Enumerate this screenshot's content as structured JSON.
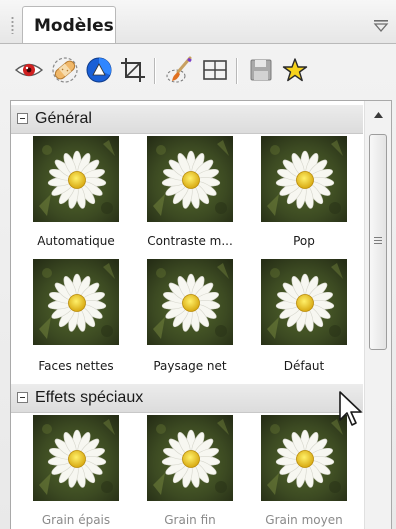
{
  "panel": {
    "tab_label": "Modèles"
  },
  "toolbar": {
    "icons": [
      "eye-icon",
      "bandage-icon",
      "color-wheel-icon",
      "crop-icon",
      "brush-icon",
      "grid-icon",
      "save-icon",
      "star-icon"
    ]
  },
  "groups": [
    {
      "label": "Général",
      "items": [
        {
          "label": "Automatique"
        },
        {
          "label": "Contraste m..."
        },
        {
          "label": "Pop"
        },
        {
          "label": "Faces nettes"
        },
        {
          "label": "Paysage net"
        },
        {
          "label": "Défaut"
        }
      ]
    },
    {
      "label": "Effets spéciaux",
      "items": [
        {
          "label": "Grain épais"
        },
        {
          "label": "Grain fin"
        },
        {
          "label": "Grain moyen"
        }
      ]
    }
  ],
  "colors": {
    "accent_blue": "#1a5fd6",
    "eye_red": "#d02020",
    "star_yellow": "#f6d21c",
    "thumb_bg": "#3e4a24"
  }
}
